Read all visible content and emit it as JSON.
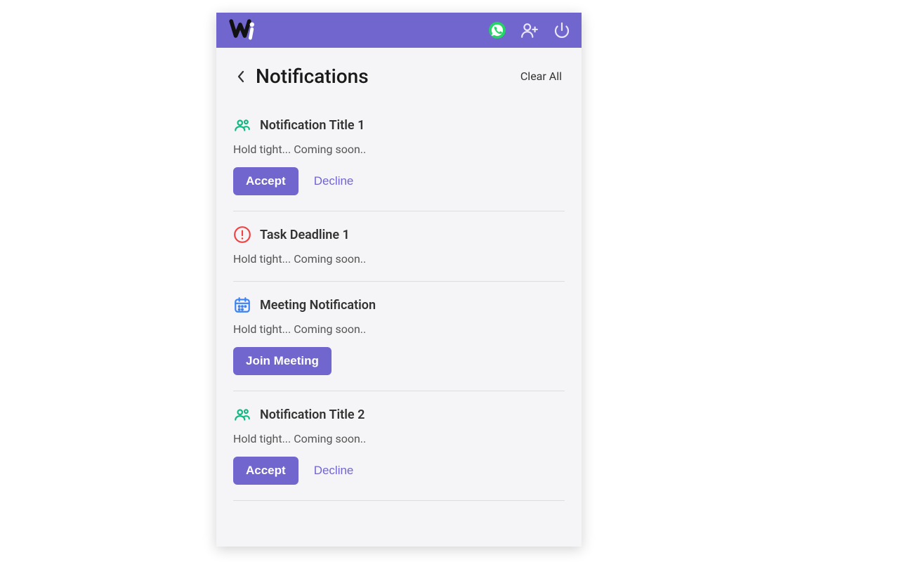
{
  "colors": {
    "brand": "#7166cd",
    "whatsapp": "#25D366",
    "green": "#10b981",
    "red": "#ef4444",
    "blue": "#3b82f6"
  },
  "header": {
    "title": "Notifications",
    "clear_all": "Clear All"
  },
  "notifications": [
    {
      "icon": "people",
      "title": "Notification Title 1",
      "body": "Hold tight... Coming soon..",
      "actions": [
        "accept",
        "decline"
      ]
    },
    {
      "icon": "alert",
      "title": "Task Deadline 1",
      "body": "Hold tight... Coming soon..",
      "actions": []
    },
    {
      "icon": "calendar",
      "title": "Meeting Notification",
      "body": "Hold tight... Coming soon..",
      "actions": [
        "join"
      ]
    },
    {
      "icon": "people",
      "title": "Notification Title 2",
      "body": "Hold tight... Coming soon..",
      "actions": [
        "accept",
        "decline"
      ]
    }
  ],
  "buttons": {
    "accept": "Accept",
    "decline": "Decline",
    "join": "Join Meeting"
  }
}
